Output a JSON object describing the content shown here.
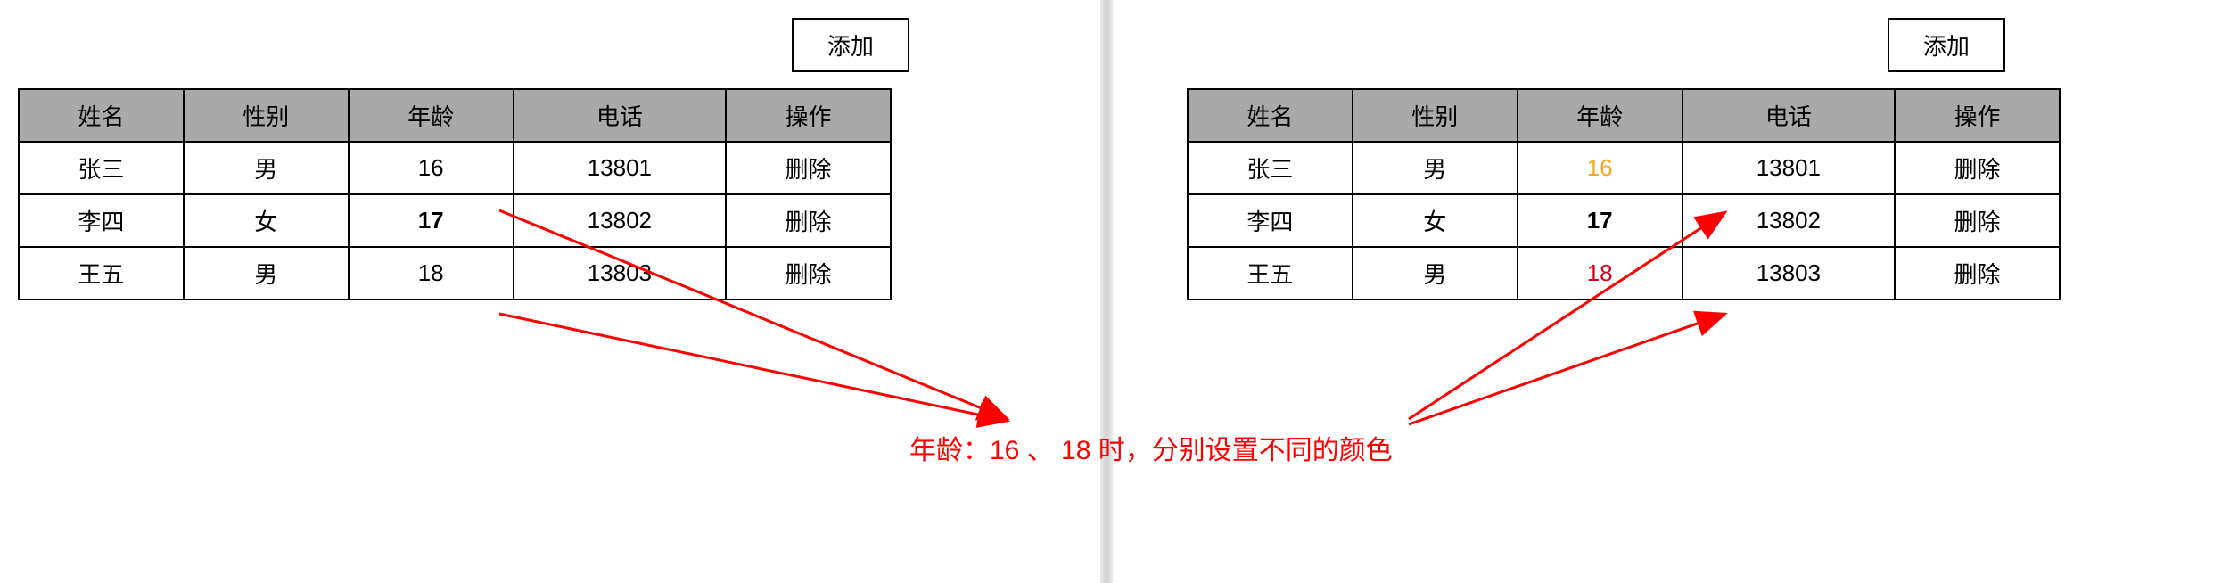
{
  "addLabel": "添加",
  "headers": [
    "姓名",
    "性别",
    "年龄",
    "电话",
    "操作"
  ],
  "rows": [
    {
      "name": "张三",
      "gender": "男",
      "age": "16",
      "phone": "13801",
      "action": "删除"
    },
    {
      "name": "李四",
      "gender": "女",
      "age": "17",
      "phone": "13802",
      "action": "删除"
    },
    {
      "name": "王五",
      "gender": "男",
      "age": "18",
      "phone": "13803",
      "action": "删除"
    }
  ],
  "annotation": "年龄：16 、 18 时，分别设置不同的颜色"
}
